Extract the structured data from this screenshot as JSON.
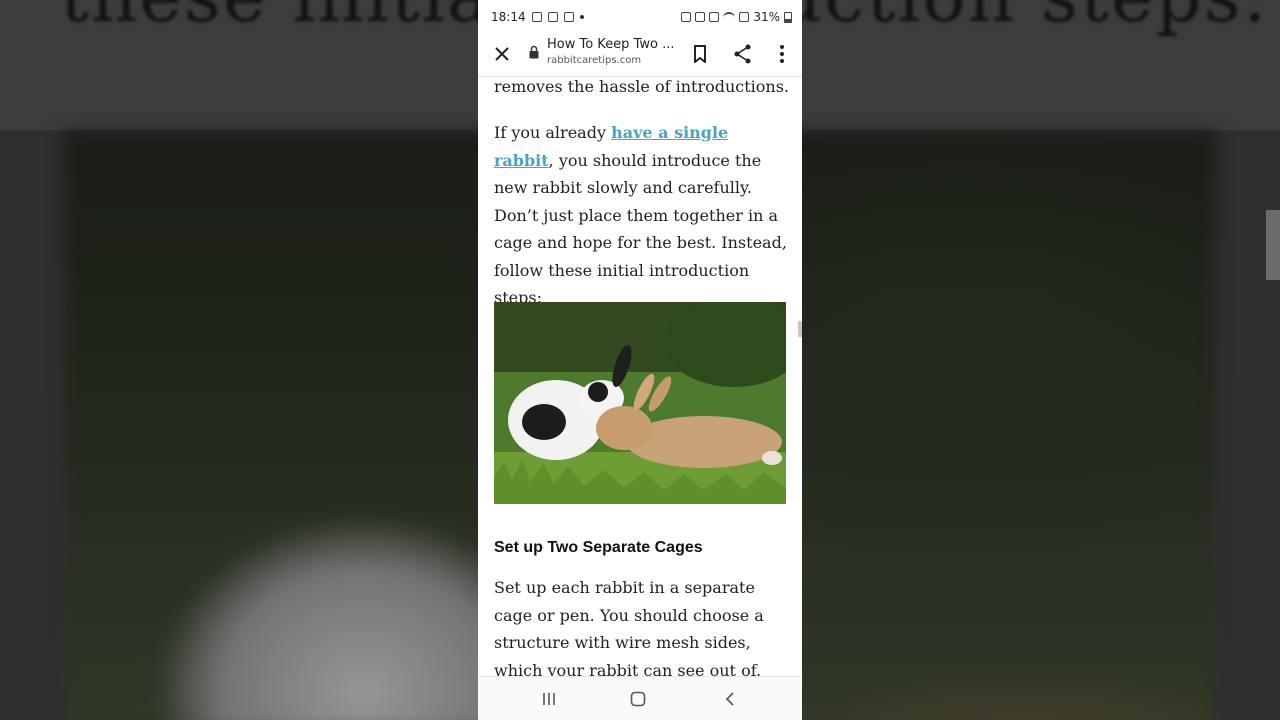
{
  "background": {
    "top_text": "these initial introduction steps:"
  },
  "status_bar": {
    "time": "18:14",
    "battery": "31%",
    "icons": [
      "screenshot-icon",
      "gallery-icon",
      "media-icon",
      "link-icon",
      "alarm-icon",
      "mute-icon",
      "wifi-icon",
      "signal-icon",
      "battery-icon"
    ]
  },
  "toolbar": {
    "title": "How To Keep Two ...",
    "url": "rabbitcaretips.com",
    "icons": [
      "close-icon",
      "lock-icon",
      "bookmark-icon",
      "share-icon",
      "more-vert-icon"
    ]
  },
  "article": {
    "p0": "removes the hassle of introductions.",
    "p1_before": "If you already ",
    "p1_link": "have a single rabbit",
    "p1_after": ", you should introduce the new rabbit slowly and carefully.  Don’t just place them together in a cage and hope for the best. Instead, follow these initial introduction steps:",
    "heading": "Set up Two Separate Cages",
    "p2": "Set up each rabbit in a separate cage or pen. You should choose a structure with wire mesh sides, which your rabbit can see out of."
  },
  "colors": {
    "link": "#4aa3c2",
    "text": "#222222"
  },
  "nav_bar": {
    "icons": [
      "recent-apps-icon",
      "home-icon",
      "back-icon"
    ]
  }
}
